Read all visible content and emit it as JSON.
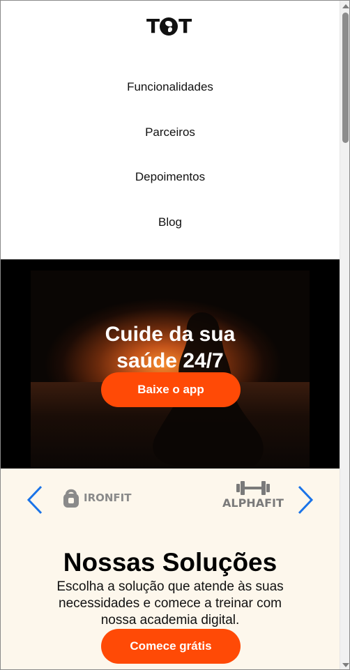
{
  "header": {
    "logo_text": "TOT",
    "nav": [
      {
        "label": "Funcionalidades"
      },
      {
        "label": "Parceiros"
      },
      {
        "label": "Depoimentos"
      },
      {
        "label": "Blog"
      }
    ]
  },
  "hero": {
    "title_line1": "Cuide da sua",
    "title_line2": "saúde 24/7",
    "cta_label": "Baixe o app"
  },
  "partners": {
    "logos": [
      {
        "name": "IRONFIT",
        "icon": "kettlebell-icon"
      },
      {
        "name": "ALPHAFIT",
        "icon": "dumbbell-icon"
      }
    ],
    "prev_icon": "chevron-left-icon",
    "next_icon": "chevron-right-icon"
  },
  "solutions": {
    "title": "Nossas Soluções",
    "description": "Escolha a solução que atende às suas necessidades e comece a treinar com nossa academia digital.",
    "cta_label": "Comece grátis"
  },
  "colors": {
    "accent": "#ff4a06",
    "arrow_blue": "#1a73e8",
    "section_bg": "#fdf7ec"
  }
}
